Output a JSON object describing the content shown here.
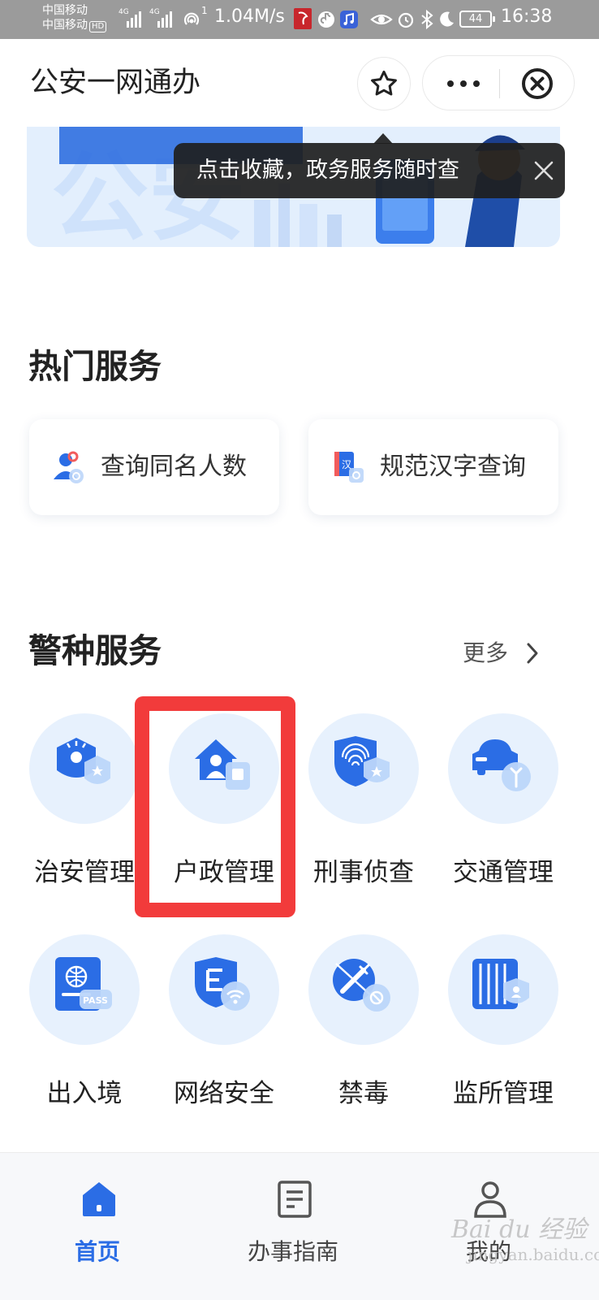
{
  "status_bar": {
    "carrier_1": "中国移动",
    "carrier_2": "中国移动",
    "hd_badge": "HD",
    "network_1": "4G",
    "network_2": "4G",
    "hotspot_label": "1",
    "net_speed": "1.04M/s",
    "battery": "44",
    "time": "16:38"
  },
  "header": {
    "title": "公安一网通办",
    "favorite_icon": "star-icon",
    "more_icon": "more-dots-icon",
    "close_icon": "close-circle-icon"
  },
  "tooltip": {
    "text": "点击收藏，政务服务随时查",
    "close_icon": "close-icon"
  },
  "hot_services": {
    "title": "热门服务",
    "items": [
      {
        "label": "查询同名人数",
        "icon": "person-search-icon"
      },
      {
        "label": "规范汉字查询",
        "icon": "chinese-character-icon"
      }
    ]
  },
  "police_services": {
    "title": "警种服务",
    "more_label": "更多",
    "items": [
      {
        "label": "治安管理",
        "icon": "police-badge-icon"
      },
      {
        "label": "户政管理",
        "icon": "household-icon"
      },
      {
        "label": "刑事侦查",
        "icon": "fingerprint-shield-icon"
      },
      {
        "label": "交通管理",
        "icon": "car-icon"
      },
      {
        "label": "出入境",
        "icon": "passport-icon"
      },
      {
        "label": "网络安全",
        "icon": "network-shield-icon"
      },
      {
        "label": "禁毒",
        "icon": "no-drugs-icon"
      },
      {
        "label": "监所管理",
        "icon": "prison-icon"
      }
    ]
  },
  "tab_bar": {
    "items": [
      {
        "label": "首页",
        "icon": "home-icon",
        "active": true
      },
      {
        "label": "办事指南",
        "icon": "guide-document-icon",
        "active": false
      },
      {
        "label": "我的",
        "icon": "profile-icon",
        "active": false
      }
    ]
  },
  "colors": {
    "accent": "#2b6de5",
    "icon_circle": "#e7f1fd",
    "highlight_border": "#f23b3b",
    "status_bar": "#9b9b9b"
  },
  "watermark": {
    "brand": "Bai du 经验",
    "sub": "jingyan.baidu.com"
  }
}
